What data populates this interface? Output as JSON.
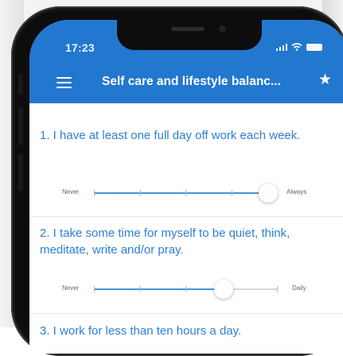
{
  "status_bar": {
    "time": "17:23"
  },
  "app_bar": {
    "title": "Self care and lifestyle balanc...",
    "menu_icon": "hamburger-menu-icon",
    "star_icon": "star-icon"
  },
  "questions": [
    {
      "text": "1. I have at least one full day off work each week.",
      "min_label": "Never",
      "max_label": "Always",
      "value": 0.95
    },
    {
      "text": "2. I take some time for myself to be quiet, think, meditate, write and/or pray.",
      "min_label": "Never",
      "max_label": "Daily",
      "value": 0.71
    },
    {
      "text": "3. I work for less than ten hours a day."
    }
  ],
  "colors": {
    "accent": "#2277cf",
    "question_text": "#2f7fd4",
    "slider_fill": "#4b8fda"
  }
}
